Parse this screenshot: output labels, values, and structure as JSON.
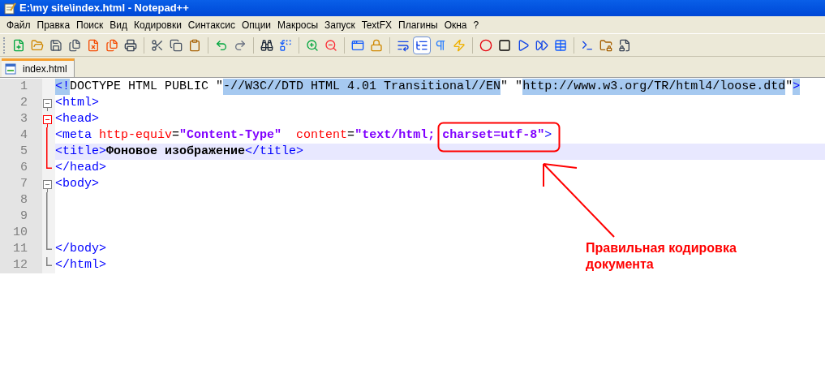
{
  "window": {
    "title": "E:\\my site\\index.html - Notepad++"
  },
  "menu": [
    "Файл",
    "Правка",
    "Поиск",
    "Вид",
    "Кодировки",
    "Синтаксис",
    "Опции",
    "Макросы",
    "Запуск",
    "TextFX",
    "Плагины",
    "Окна",
    "?"
  ],
  "toolbar": [
    {
      "selected": false
    },
    {
      "selected": false
    },
    {
      "selected": false
    },
    {
      "selected": false
    },
    {
      "selected": false
    },
    {
      "selected": false
    },
    {
      "selected": false
    },
    {
      "selected": false
    },
    {
      "selected": false
    },
    {
      "selected": false
    },
    {
      "selected": false
    },
    {
      "selected": false
    },
    {
      "selected": false
    },
    {
      "selected": false
    },
    {
      "selected": false
    },
    {
      "selected": false
    },
    {
      "selected": false
    },
    {
      "selected": false
    },
    {
      "selected": false
    },
    {
      "selected": true
    },
    {
      "selected": false
    },
    {
      "selected": false
    },
    {
      "selected": false
    },
    {
      "selected": false
    },
    {
      "selected": false
    },
    {
      "selected": false
    },
    {
      "selected": false
    },
    {
      "selected": false
    },
    {
      "selected": false
    },
    {
      "selected": false
    }
  ],
  "tabs": [
    {
      "label": "index.html",
      "selected": true
    }
  ],
  "editor": {
    "lines": [
      {
        "number": "1",
        "current": false,
        "tokens": [
          {
            "kind": "tag",
            "text": "<!",
            "highlighted": true
          },
          {
            "kind": "plain",
            "text": "DOCTYPE HTML PUBLIC \"",
            "highlighted": false
          },
          {
            "kind": "plain",
            "text": "-//W3C//DTD HTML 4.01 Transitional//EN",
            "highlighted": true
          },
          {
            "kind": "plain",
            "text": "\" \"",
            "highlighted": false
          },
          {
            "kind": "plain",
            "text": "http://www.w3.org/TR/html4/loose.dtd",
            "highlighted": true
          },
          {
            "kind": "plain",
            "text": "\"",
            "highlighted": false
          },
          {
            "kind": "tag",
            "text": ">",
            "highlighted": true
          }
        ]
      },
      {
        "number": "2",
        "fold": {
          "kind": "box",
          "active": false
        },
        "current": false,
        "tokens": [
          {
            "kind": "tag",
            "text": "<html>",
            "highlighted": false
          }
        ]
      },
      {
        "number": "3",
        "fold": {
          "kind": "box",
          "active": true
        },
        "current": false,
        "tokens": [
          {
            "kind": "tag",
            "text": "<head>",
            "highlighted": false
          }
        ]
      },
      {
        "number": "4",
        "fold": {
          "kind": "line",
          "active": true
        },
        "current": false,
        "tokens": [
          {
            "kind": "tag",
            "text": "<meta",
            "highlighted": false
          },
          {
            "kind": "attr",
            "text": " http-equiv",
            "highlighted": false
          },
          {
            "kind": "plain",
            "text": "=",
            "highlighted": false
          },
          {
            "kind": "value",
            "text": "\"Content-Type\"",
            "highlighted": false
          },
          {
            "kind": "attr",
            "text": "  content",
            "highlighted": false
          },
          {
            "kind": "plain",
            "text": "=",
            "highlighted": false
          },
          {
            "kind": "value",
            "text": "\"text/html; charset=utf-8\"",
            "highlighted": false
          },
          {
            "kind": "tag",
            "text": ">",
            "highlighted": false
          }
        ]
      },
      {
        "number": "5",
        "fold": {
          "kind": "line",
          "active": true
        },
        "current": true,
        "tokens": [
          {
            "kind": "tag",
            "text": "<title>",
            "highlighted": false
          },
          {
            "kind": "text",
            "text": "Фоновое изображение",
            "highlighted": false
          },
          {
            "kind": "tag",
            "text": "</title>",
            "highlighted": false
          }
        ]
      },
      {
        "number": "6",
        "fold": {
          "kind": "end",
          "active": true
        },
        "current": false,
        "tokens": [
          {
            "kind": "tag",
            "text": "</head>",
            "highlighted": false
          }
        ]
      },
      {
        "number": "7",
        "fold": {
          "kind": "box",
          "active": false
        },
        "current": false,
        "tokens": [
          {
            "kind": "tag",
            "text": "<body>",
            "highlighted": false
          }
        ]
      },
      {
        "number": "8",
        "fold": {
          "kind": "line",
          "active": false
        },
        "current": false
      },
      {
        "number": "9",
        "fold": {
          "kind": "line",
          "active": false
        },
        "current": false
      },
      {
        "number": "10",
        "fold": {
          "kind": "line",
          "active": false
        },
        "current": false
      },
      {
        "number": "11",
        "fold": {
          "kind": "end",
          "active": false
        },
        "current": false,
        "tokens": [
          {
            "kind": "tag",
            "text": "</body>",
            "highlighted": false
          }
        ]
      },
      {
        "number": "12",
        "fold": {
          "kind": "end",
          "active": false
        },
        "current": false,
        "tokens": [
          {
            "kind": "tag",
            "text": "</html>",
            "highlighted": false
          }
        ]
      }
    ]
  },
  "annotation": {
    "text": "Правильная кодировка документа"
  }
}
